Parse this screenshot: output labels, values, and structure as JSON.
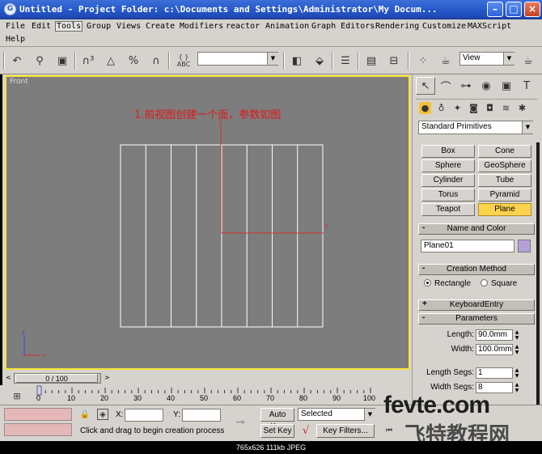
{
  "window": {
    "title": "Untitled    - Project Folder: c:\\Documents and Settings\\Administrator\\My Docum...",
    "icon_letter": "G",
    "minimize": "–",
    "maximize": "□",
    "close": "×"
  },
  "menus": [
    "File",
    "Edit",
    "Tools",
    "Group",
    "Views",
    "Create",
    "Modifiers",
    "reactor",
    "Animation",
    "Graph Editors",
    "Rendering",
    "Customize",
    "MAXScript",
    "Help"
  ],
  "active_menu": "Tools",
  "toolbar": {
    "selection_set_value": "",
    "view_dropdown": "View",
    "icons": [
      "undo-icon",
      "link-icon",
      "bind-space-warp-icon",
      "snap-3d-icon",
      "angle-snap-icon",
      "percent-snap-icon",
      "spinner-snap-icon",
      "edit-named-selection-icon",
      "mirror-icon",
      "align-icon",
      "layer-manager-icon",
      "curve-editor-icon",
      "schematic-view-icon",
      "material-editor-icon",
      "render-scene-icon",
      "quick-render-icon"
    ],
    "abc_label": "ABC"
  },
  "viewport": {
    "label": "Front",
    "annotation": "1.前视图创建一个面，参数如图",
    "axis_y": "y",
    "axis_x": "x",
    "gizmo_z": "z",
    "gizmo_x": "x",
    "plane": {
      "columns": 8
    }
  },
  "timeslider": {
    "value": "0 / 100",
    "prev": "<",
    "next": ">"
  },
  "trackbar": {
    "ticks": [
      "0",
      "10",
      "20",
      "30",
      "40",
      "50",
      "60",
      "70",
      "80",
      "90",
      "100"
    ]
  },
  "status": {
    "x_label": "X:",
    "y_label": "Y:",
    "x_value": "",
    "y_value": "",
    "auto_key": "Auto Key",
    "set_key": "Set Key",
    "key_mode": "Selected",
    "key_filters": "Key Filters...",
    "prompt": "Click and drag to begin creation process"
  },
  "command_panel": {
    "tabs": [
      "create-tab",
      "modify-tab",
      "hierarchy-tab",
      "motion-tab",
      "display-tab",
      "utilities-tab"
    ],
    "categories": [
      "geometry-icon",
      "shapes-icon",
      "lights-icon",
      "cameras-icon",
      "helpers-icon",
      "space-warps-icon",
      "systems-icon"
    ],
    "primitive_type": "Standard Primitives",
    "objects": [
      "Box",
      "Cone",
      "Sphere",
      "GeoSphere",
      "Cylinder",
      "Tube",
      "Torus",
      "Pyramid",
      "Teapot",
      "Plane"
    ],
    "active_object": "Plane",
    "name_and_color": {
      "header": "Name and Color",
      "name": "Plane01",
      "color": "#b3a0d8"
    },
    "creation_method": {
      "header": "Creation Method",
      "rectangle": "Rectangle",
      "square": "Square",
      "selected": "Rectangle"
    },
    "keyboard_entry": {
      "header": "KeyboardEntry"
    },
    "parameters": {
      "header": "Parameters",
      "length_label": "Length:",
      "length": "90.0mm",
      "width_label": "Width:",
      "width": "100.0mm",
      "length_segs_label": "Length Segs:",
      "length_segs": "1",
      "width_segs_label": "Width Segs:",
      "width_segs": "8"
    }
  },
  "caption": "765x626  111kb  JPEG",
  "watermark": {
    "line1": "fevte.com",
    "line2": "飞特教程网"
  }
}
